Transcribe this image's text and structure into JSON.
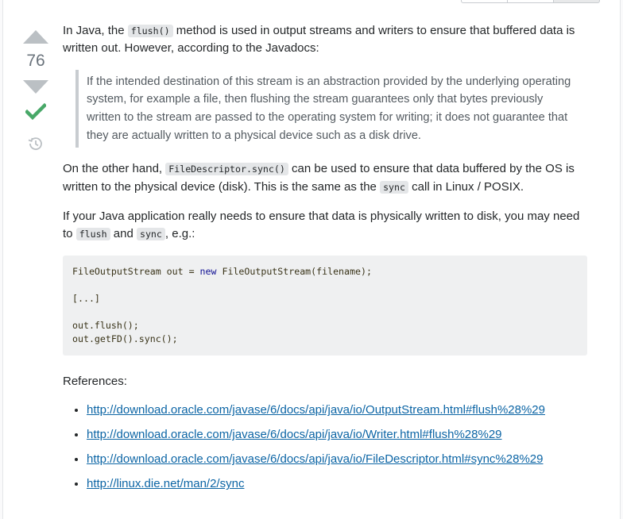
{
  "vote": {
    "count": "76",
    "up_label": "Vote up",
    "down_label": "Vote down"
  },
  "answer": {
    "intro_1": "In Java, the ",
    "intro_code": "flush()",
    "intro_2": " method is used in output streams and writers to ensure that buffered data is written out. However, according to the Javadocs:",
    "quote": "If the intended destination of this stream is an abstraction provided by the underlying operating system, for example a file, then flushing the stream guarantees only that bytes previously written to the stream are passed to the operating system for writing; it does not guarantee that they are actually written to a physical device such as a disk drive.",
    "p2_1": "On the other hand, ",
    "p2_code1": "FileDescriptor.sync()",
    "p2_2": " can be used to ensure that data buffered by the OS is written to the physical device (disk). This is the same as the ",
    "p2_code2": "sync",
    "p2_3": " call in Linux / POSIX.",
    "p3_1": "If your Java application really needs to ensure that data is physically written to disk, you may need to ",
    "p3_code1": "flush",
    "p3_2": " and ",
    "p3_code2": "sync",
    "p3_3": ", e.g.:",
    "code": {
      "line1_a": "FileOutputStream out = ",
      "line1_kw": "new",
      "line1_b": " FileOutputStream(filename);",
      "line2": "",
      "line3": "[...]",
      "line4": "",
      "line5": "out.flush();",
      "line6": "out.getFD().sync();"
    },
    "references_label": "References:",
    "references": [
      "http://download.oracle.com/javase/6/docs/api/java/io/OutputStream.html#flush%28%29",
      "http://download.oracle.com/javase/6/docs/api/java/io/Writer.html#flush%28%29",
      "http://download.oracle.com/javase/6/docs/api/java/io/FileDescriptor.html#sync%28%29",
      "http://linux.die.net/man/2/sync"
    ]
  },
  "colors": {
    "vote_arrow": "#bbc0c4",
    "accepted_check": "#48a868",
    "link": "#0c65a5",
    "code_bg": "#eff0f1",
    "quote_border": "#c8ccd0"
  }
}
